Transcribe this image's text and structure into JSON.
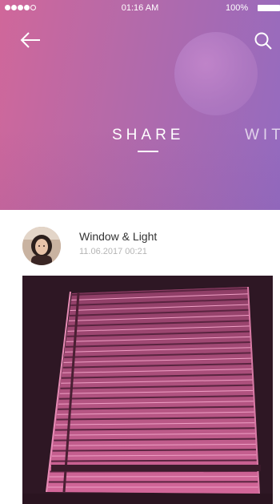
{
  "status_bar": {
    "time": "01:16 AM",
    "battery": "100%"
  },
  "header": {
    "back_icon": "arrow-left-icon",
    "search_icon": "search-icon",
    "tabs": [
      {
        "label": "SHARE",
        "active": true
      },
      {
        "label": "WIT",
        "active": false
      }
    ]
  },
  "post": {
    "title": "Window & Light",
    "date": "11.06.2017 00:21"
  },
  "colors": {
    "gradient_start": "#d0679a",
    "gradient_end": "#946bc0",
    "photo_tint": "#e0689e"
  }
}
